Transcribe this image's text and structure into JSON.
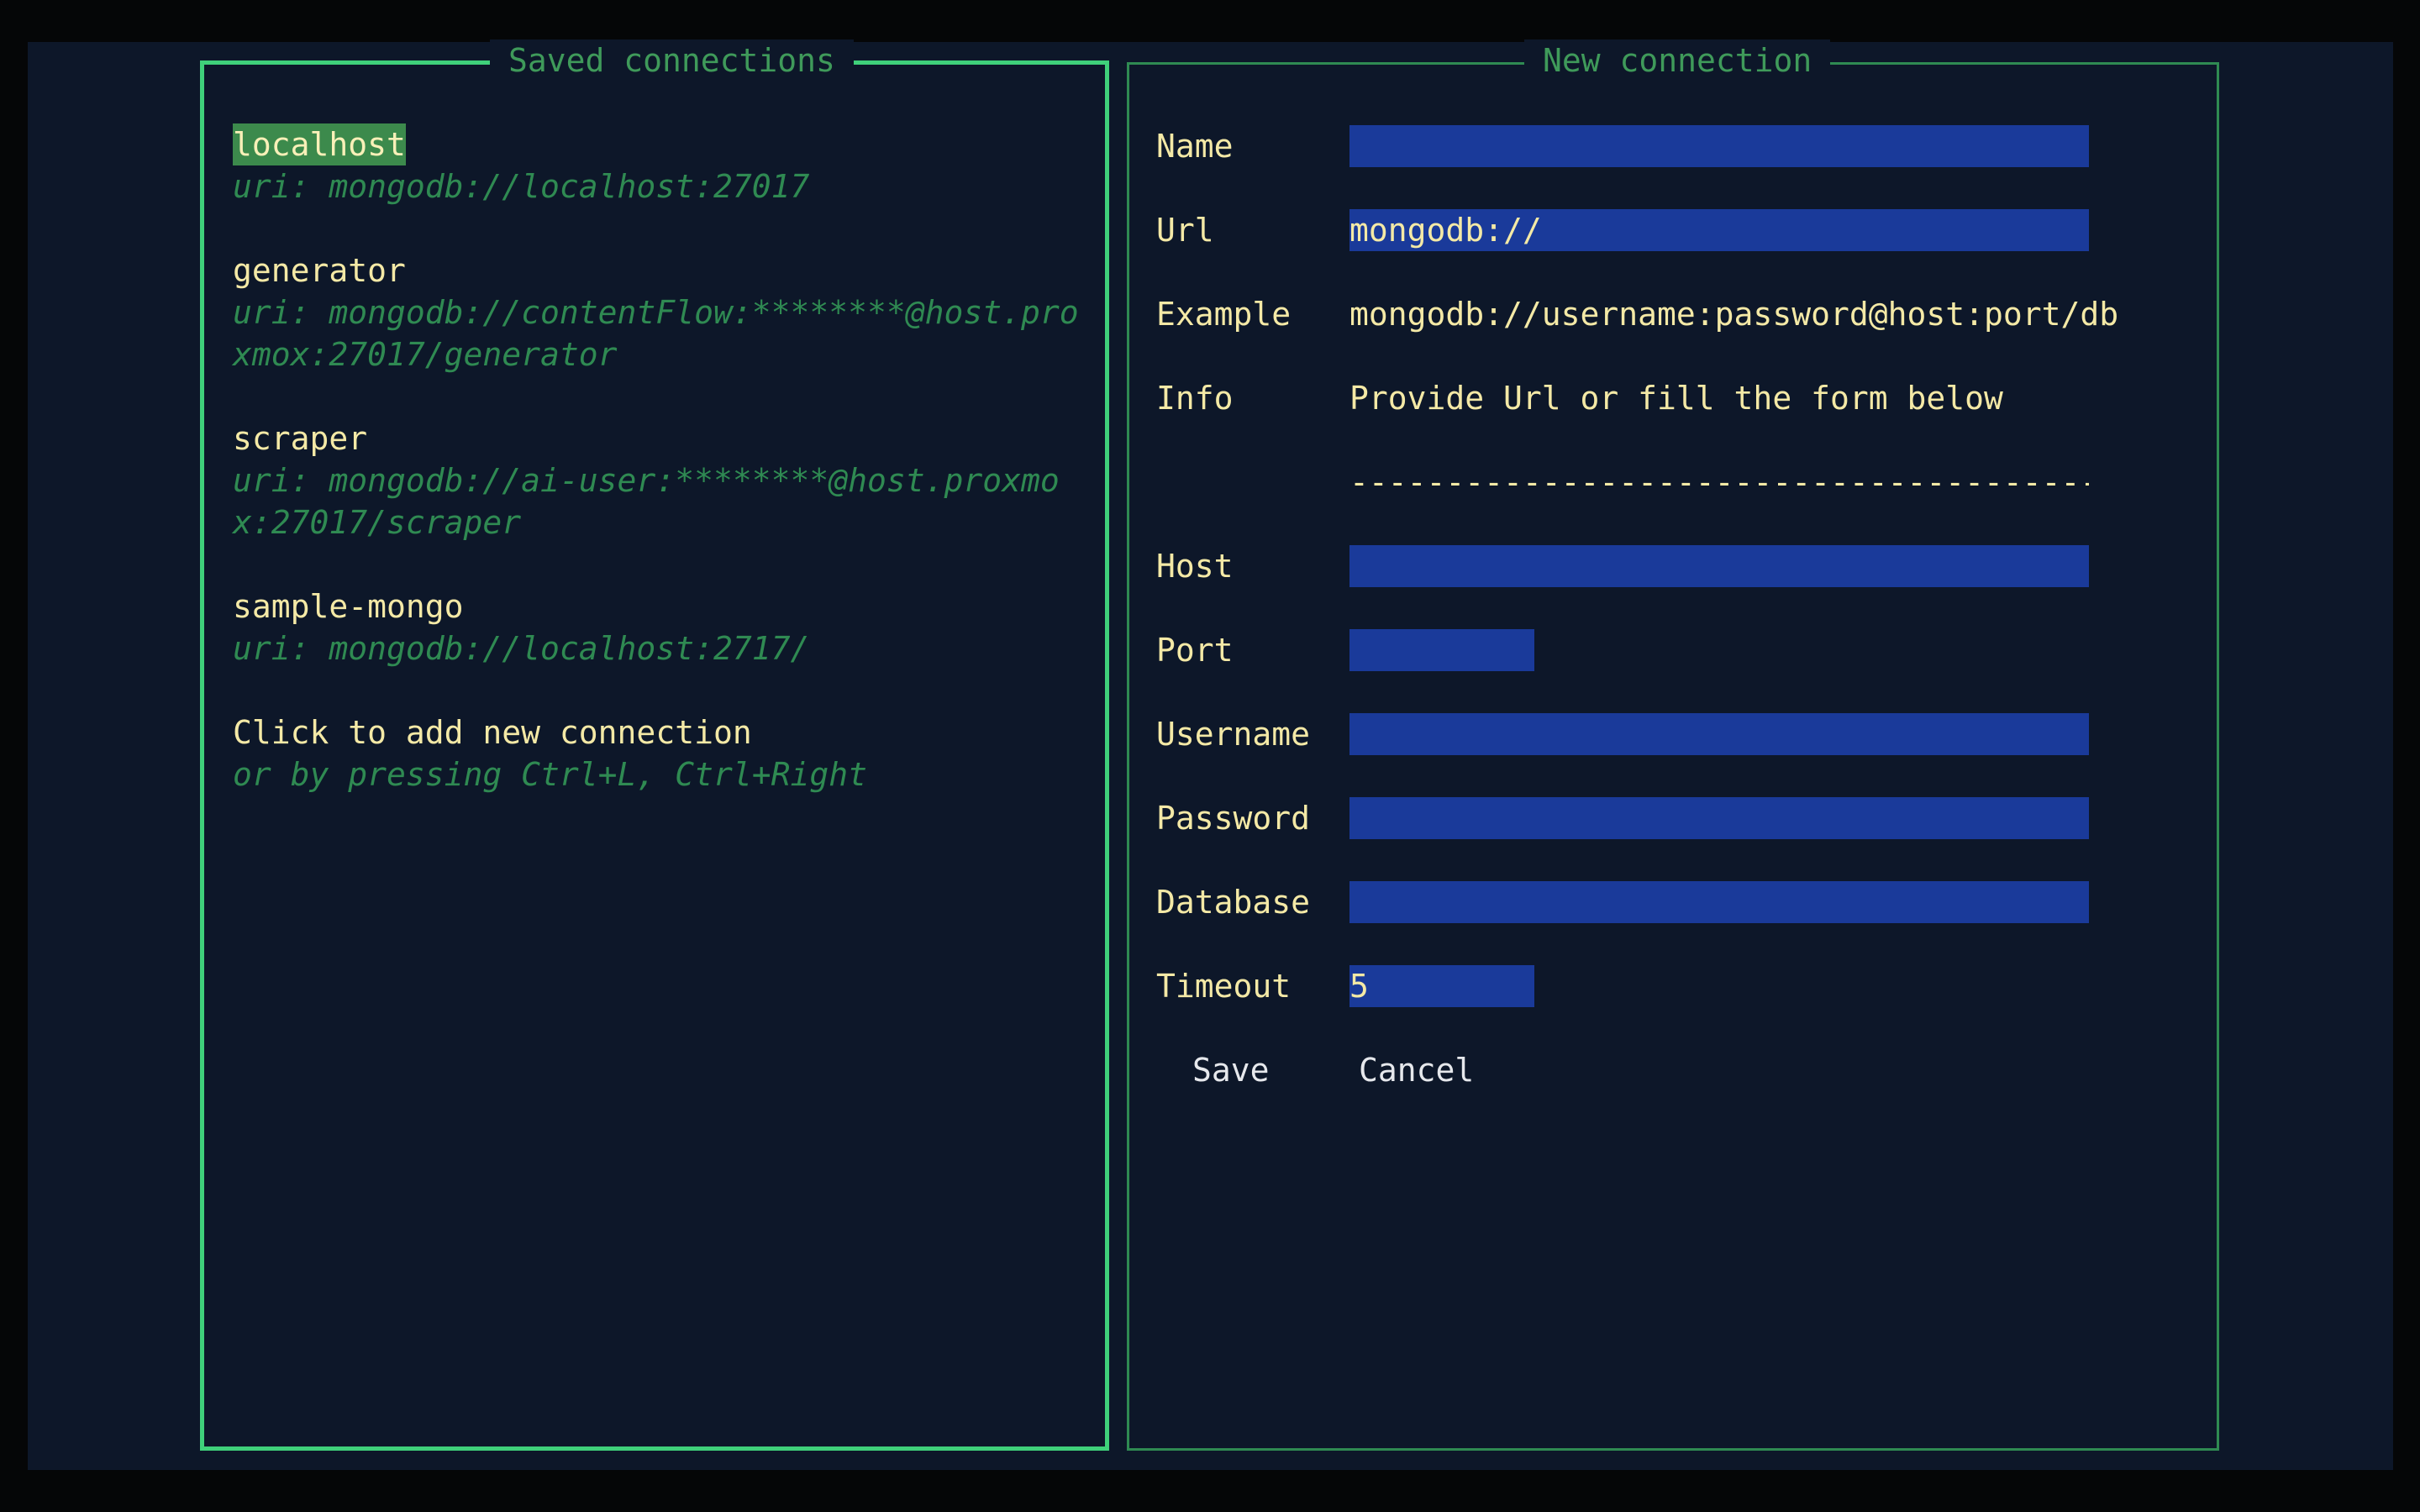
{
  "saved_panel": {
    "title": "Saved connections",
    "connections": [
      {
        "name": "localhost",
        "uri": "uri: mongodb://localhost:27017",
        "selected": true
      },
      {
        "name": "generator",
        "uri": "uri: mongodb://contentFlow:********@host.proxmox:27017/generator",
        "selected": false
      },
      {
        "name": "scraper",
        "uri": "uri: mongodb://ai-user:********@host.proxmox:27017/scraper",
        "selected": false
      },
      {
        "name": "sample-mongo",
        "uri": "uri: mongodb://localhost:2717/",
        "selected": false
      }
    ],
    "add_connection": {
      "title": "Click to add new connection",
      "hint": "or by pressing Ctrl+L, Ctrl+Right"
    }
  },
  "form_panel": {
    "title": "New connection",
    "fields": {
      "name": {
        "label": "Name",
        "value": ""
      },
      "url": {
        "label": "Url",
        "value": "mongodb://"
      },
      "example": {
        "label": "Example",
        "value": "mongodb://username:password@host:port/db"
      },
      "info": {
        "label": "Info",
        "value": "Provide Url or fill the form below"
      },
      "separator": "----------------------------------------",
      "host": {
        "label": "Host",
        "value": ""
      },
      "port": {
        "label": "Port",
        "value": ""
      },
      "username": {
        "label": "Username",
        "value": ""
      },
      "password": {
        "label": "Password",
        "value": ""
      },
      "database": {
        "label": "Database",
        "value": ""
      },
      "timeout": {
        "label": "Timeout",
        "value": "5"
      }
    },
    "buttons": {
      "save": "Save",
      "cancel": "Cancel"
    }
  },
  "colors": {
    "background": "#0d1729",
    "active_border": "#3fd07a",
    "inactive_border": "#2f8a52",
    "text": "#f4e9a6",
    "muted": "#2f8a52",
    "input_bg": "#1a3a9a",
    "selection_bg": "#3c8a4c"
  }
}
